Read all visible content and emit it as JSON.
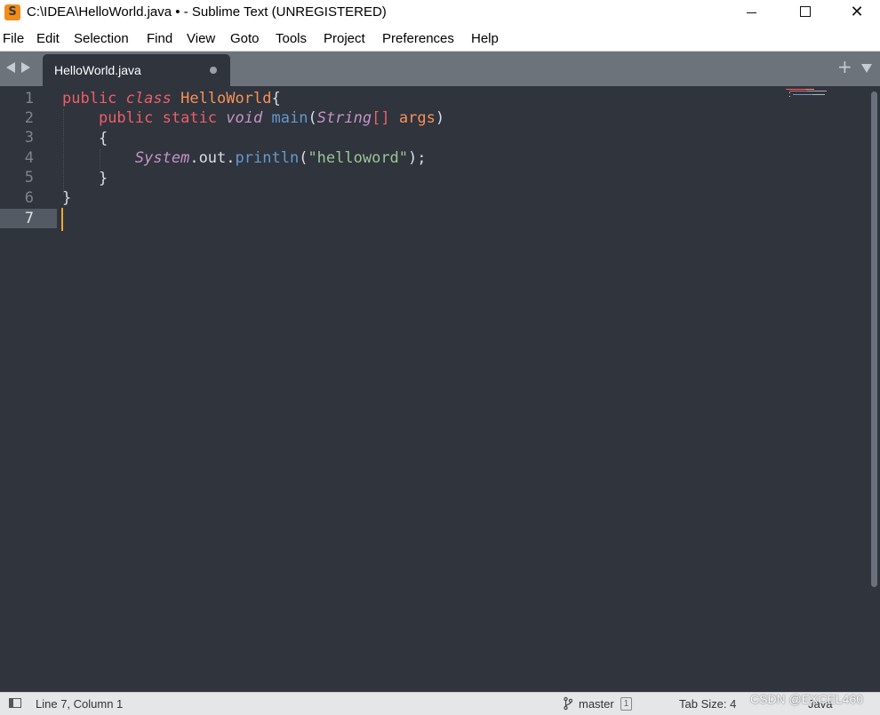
{
  "window": {
    "icon_letter": "S",
    "title": "C:\\IDEA\\HelloWorld.java • - Sublime Text (UNREGISTERED)",
    "close_glyph": "✕"
  },
  "menu": [
    "File",
    "Edit",
    "Selection",
    "Find",
    "View",
    "Goto",
    "Tools",
    "Project",
    "Preferences",
    "Help"
  ],
  "tabs": [
    {
      "label": "HelloWorld.java",
      "dirty": true
    }
  ],
  "tabbar": {
    "new_tab_glyph": "+"
  },
  "editor": {
    "line_numbers": [
      "1",
      "2",
      "3",
      "4",
      "5",
      "6",
      "7"
    ],
    "active_line": "7",
    "code": {
      "l1": {
        "public": "public",
        "class": "class",
        "name": "HelloWorld",
        "brace": "{"
      },
      "l2": {
        "public": "public",
        "static": "static",
        "void": "void",
        "main": "main",
        "paren_open": "(",
        "string": "String",
        "brackets": "[]",
        "args": "args",
        "paren_close": ")"
      },
      "l3": {
        "brace": "{"
      },
      "l4": {
        "system": "System",
        "dot1": ".",
        "out": "out",
        "dot2": ".",
        "println": "println",
        "paren_open": "(",
        "literal": "\"helloword\"",
        "paren_close": ");"
      },
      "l5": {
        "brace": "}"
      },
      "l6": {
        "brace": "}"
      }
    }
  },
  "status": {
    "position": "Line 7, Column 1",
    "branch": "master",
    "badge": "1",
    "tab_size": "Tab Size: 4",
    "syntax": "Java"
  },
  "watermark": "CSDN @EXCEL460",
  "colors": {
    "keyword": "#ec5f67",
    "class_name": "#f99157",
    "function": "#6699cc",
    "string": "#99c794",
    "type": "#c594c5",
    "caret": "#f5a732",
    "editor_bg": "#2f343d"
  }
}
